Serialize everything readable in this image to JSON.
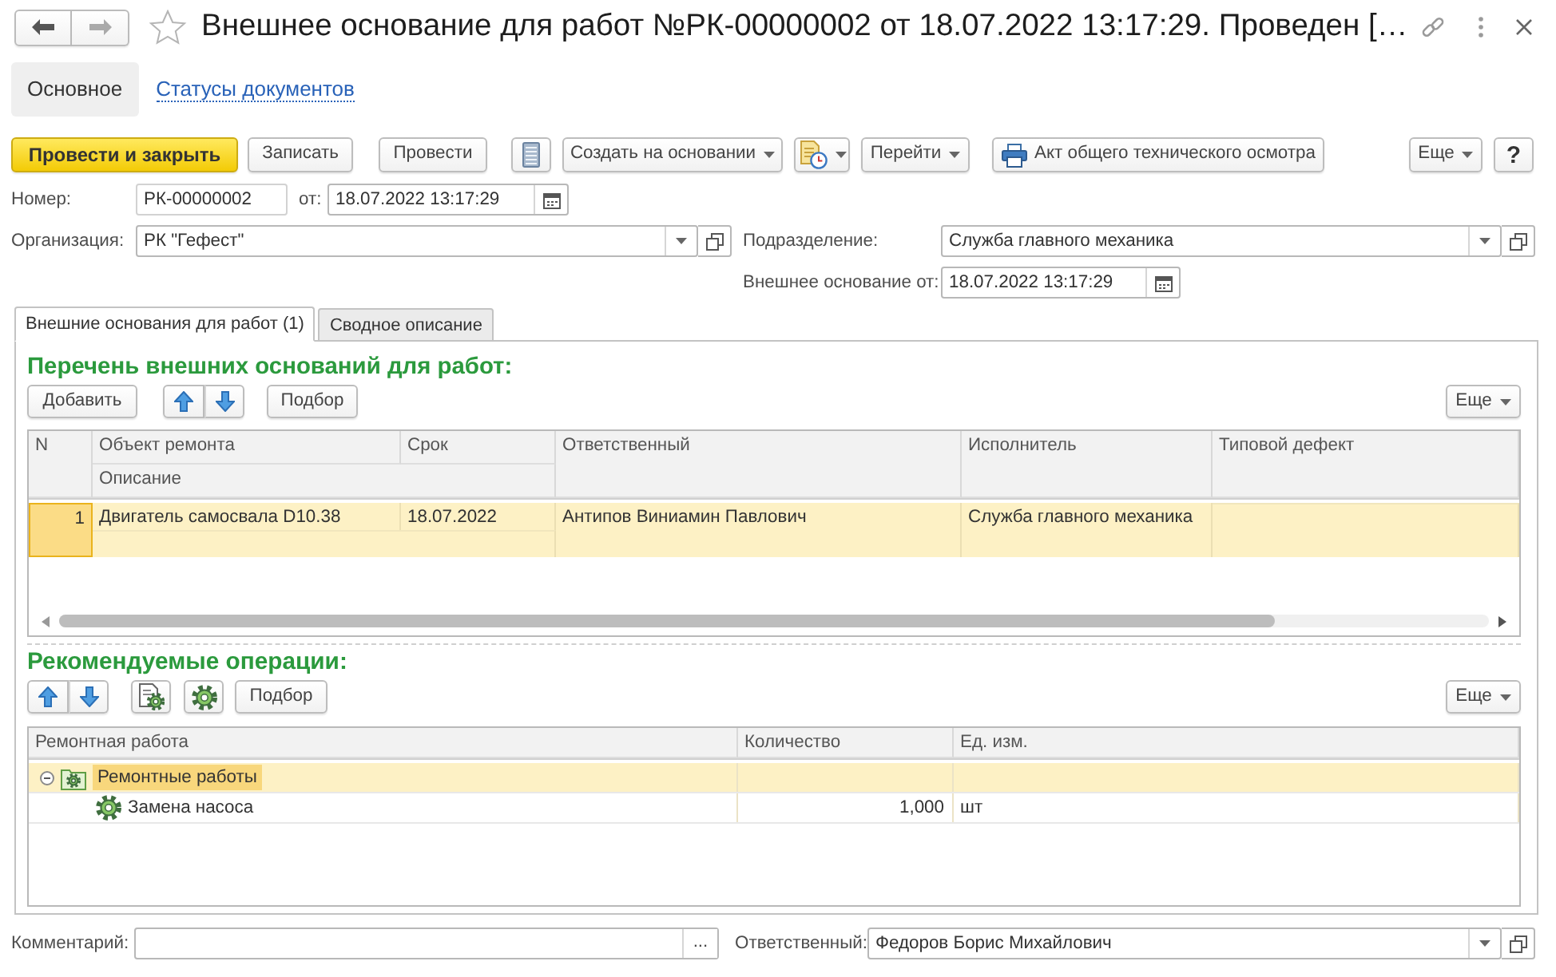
{
  "window": {
    "title": "Внешнее основание для работ №РК-00000002 от 18.07.2022 13:17:29. Проведен […"
  },
  "nav": [
    {
      "label": "Основное",
      "selected": true
    },
    {
      "label": "Статусы документов",
      "selected": false
    }
  ],
  "toolbar": {
    "post_and_close": "Провести и закрыть",
    "save": "Записать",
    "post": "Провести",
    "create_based_on": "Создать на основании",
    "go_to": "Перейти",
    "print": "Акт общего технического осмотра",
    "more": "Еще",
    "help": "?"
  },
  "fields": {
    "number": {
      "label": "Номер:",
      "value": "РК-00000002"
    },
    "date": {
      "label": "от:",
      "value": "18.07.2022 13:17:29"
    },
    "organization": {
      "label": "Организация:",
      "value": "РК \"Гефест\""
    },
    "department": {
      "label": "Подразделение:",
      "value": "Служба главного механика"
    },
    "external_basis_date": {
      "label": "Внешнее основание от:",
      "value": "18.07.2022 13:17:29"
    }
  },
  "tabs": [
    {
      "label": "Внешние основания для работ (1)",
      "selected": true
    },
    {
      "label": "Сводное описание",
      "selected": false
    }
  ],
  "basis_list": {
    "title": "Перечень внешних оснований для работ:",
    "toolbar": {
      "add": "Добавить",
      "pick": "Подбор",
      "more": "Еще"
    },
    "columns": [
      "N",
      "Объект ремонта",
      "Срок",
      "Ответственный",
      "Исполнитель",
      "Типовой дефект"
    ],
    "sub_column": "Описание",
    "rows": [
      {
        "n": "1",
        "object": "Двигатель самосвала D10.38",
        "due": "18.07.2022",
        "responsible": "Антипов Виниамин Павлович",
        "executor": "Служба главного механика",
        "selected": true
      }
    ]
  },
  "operations": {
    "title": "Рекомендуемые операции:",
    "toolbar": {
      "pick": "Подбор",
      "more": "Еще"
    },
    "columns": [
      "Ремонтная работа",
      "Количество",
      "Ед. изм."
    ],
    "rows": [
      {
        "kind": "group",
        "name": "Ремонтные работы",
        "selected": true,
        "expanded": true,
        "children": [
          {
            "kind": "operation",
            "name": "Замена насоса",
            "quantity": "1,000",
            "unit": "шт",
            "selected": false
          }
        ]
      }
    ]
  },
  "footer": {
    "comment": {
      "label": "Комментарий:",
      "button": "..."
    },
    "responsible": {
      "label": "Ответственный:",
      "value": "Федоров Борис Михайлович"
    }
  }
}
